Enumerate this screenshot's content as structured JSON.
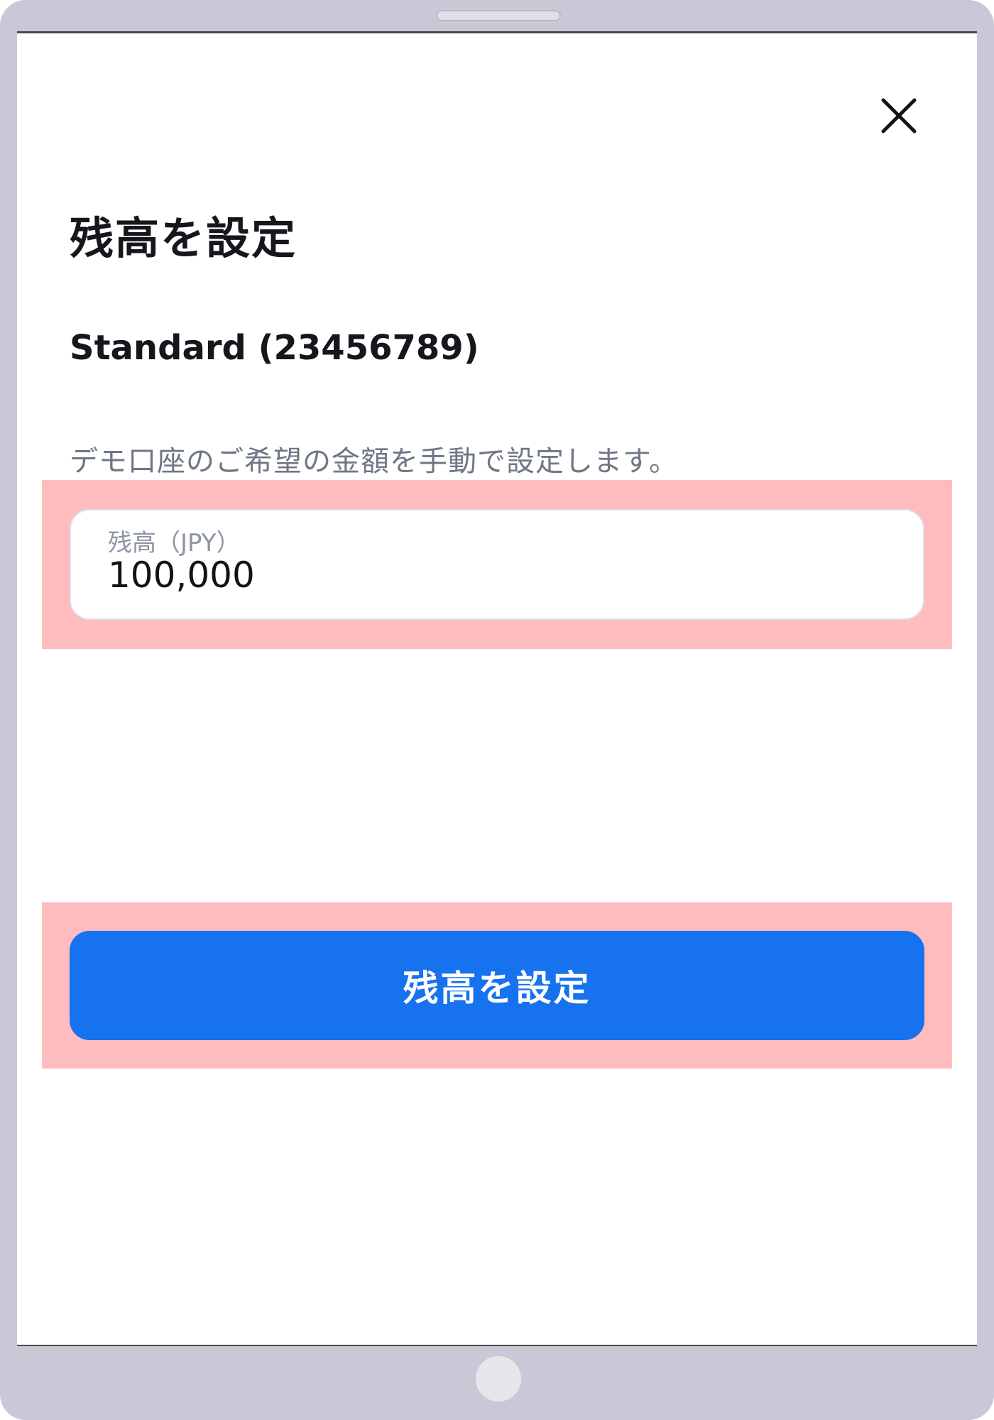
{
  "header": {
    "close_icon": "close-icon"
  },
  "dialog": {
    "title": "残高を設定",
    "account_label": "Standard (23456789)",
    "description": "デモ口座のご希望の金額を手動で設定します。"
  },
  "balance_input": {
    "label": "残高（JPY）",
    "value": "100,000"
  },
  "submit": {
    "label": "残高を設定"
  },
  "colors": {
    "primary": "#1672ee",
    "highlight": "#ffbcbe",
    "device_frame": "#c8c8d6"
  }
}
